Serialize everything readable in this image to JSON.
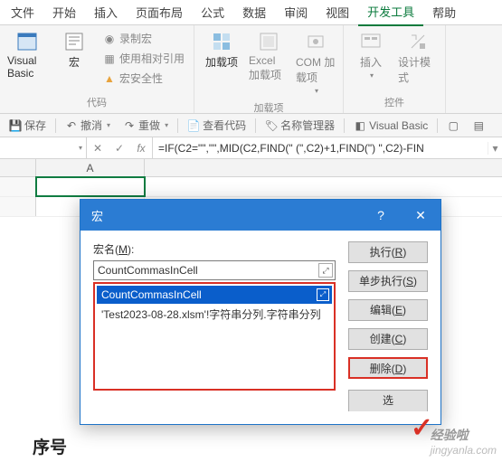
{
  "tabs": [
    "文件",
    "开始",
    "插入",
    "页面布局",
    "公式",
    "数据",
    "审阅",
    "视图",
    "开发工具",
    "帮助"
  ],
  "active_tab_index": 8,
  "ribbon": {
    "g_code": {
      "vb": "Visual Basic",
      "macro": "宏",
      "rec": "录制宏",
      "rel": "使用相对引用",
      "sec": "宏安全性",
      "label": "代码"
    },
    "g_addins": {
      "addins": "加载项",
      "excel": "Excel 加载项",
      "com": "COM 加载项",
      "label": "加载项"
    },
    "g_controls": {
      "insert": "插入",
      "design": "设计模式",
      "label": "控件"
    }
  },
  "quickbar": {
    "save": "保存",
    "undo": "撤消",
    "redo": "重做",
    "viewcode": "查看代码",
    "namemgr": "名称管理器",
    "vb": "Visual Basic"
  },
  "formula_bar": {
    "fx": "fx",
    "formula": "=IF(C2=\"\",\"\",MID(C2,FIND(\"  (\",C2)+1,FIND(\")  \",C2)-FIN"
  },
  "columns": [
    "A"
  ],
  "dialog": {
    "title": "宏",
    "name_label_pre": "宏名(",
    "name_label_u": "M",
    "name_label_post": "):",
    "name_value": "CountCommasInCell",
    "list": [
      "CountCommasInCell",
      "'Test2023-08-28.xlsm'!字符串分列.字符串分列"
    ],
    "btn_run_pre": "执行(",
    "btn_run_u": "R",
    "btn_run_post": ")",
    "btn_step_pre": "单步执行(",
    "btn_step_u": "S",
    "btn_step_post": ")",
    "btn_edit_pre": "编辑(",
    "btn_edit_u": "E",
    "btn_edit_post": ")",
    "btn_create_pre": "创建(",
    "btn_create_u": "C",
    "btn_create_post": ")",
    "btn_delete_pre": "删除(",
    "btn_delete_u": "D",
    "btn_delete_post": ")",
    "btn_opt": "选"
  },
  "bottom_text": "序号",
  "watermark": {
    "check": "✓",
    "text": "经验啦",
    "url": "jingyanla.com"
  }
}
